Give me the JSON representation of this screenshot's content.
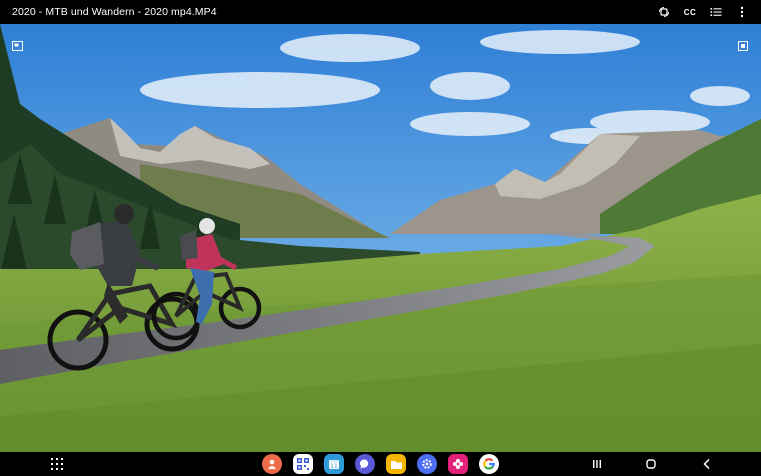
{
  "window": {
    "title": "2020 - MTB und Wandern - 2020 mp4.MP4"
  },
  "toolbar": {
    "captions_label": "CC"
  },
  "icons": {
    "rotate": "screen-rotate-icon",
    "captions": "closed-captions-icon",
    "playlist": "playlist-icon",
    "menu": "more-vertical-icon",
    "popup": "popup-view-icon",
    "capture": "screen-capture-icon"
  },
  "dock": {
    "apps": [
      {
        "name": "contacts",
        "color": "#ef6c4a"
      },
      {
        "name": "qr-scanner",
        "color": "#ffffff"
      },
      {
        "name": "calendar",
        "color": "#2f9ad8"
      },
      {
        "name": "messages",
        "color": "#5a5ad6"
      },
      {
        "name": "my-files",
        "color": "#f4b400"
      },
      {
        "name": "settings",
        "color": "#4c6ef5"
      },
      {
        "name": "gallery",
        "color": "#e2237a"
      },
      {
        "name": "google",
        "color": "#ffffff"
      }
    ]
  },
  "navigation": {
    "buttons": [
      "recent-apps",
      "home",
      "back"
    ]
  }
}
